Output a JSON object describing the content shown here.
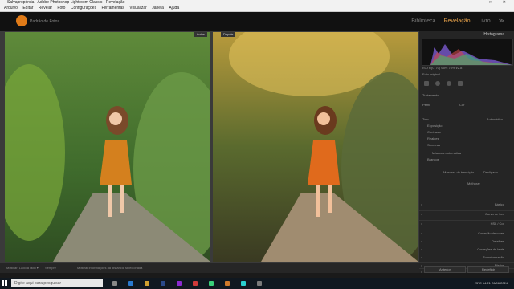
{
  "window": {
    "title": "Salvapropórcia - Adobe Photoshop Lightroom Classic - Revelação",
    "controls": "–  □  ✕"
  },
  "menu": [
    "Arquivo",
    "Editar",
    "Revelar",
    "Foto",
    "Configurações",
    "Ferramentas",
    "Visualizar",
    "Janela",
    "Ajuda"
  ],
  "identity": {
    "logo_text": "Padrão de Fotos",
    "modules": [
      "Biblioteca",
      "Revelação",
      "Livro",
      "≫"
    ],
    "active_module": "Revelação"
  },
  "views": {
    "before_label": "Antes",
    "after_label": "Depois"
  },
  "bottom_toolbar": {
    "left": "Mostrar: Lado a lado  ▾",
    "swap": "Sempre",
    "middle": "Mostrar informações da distância selecionada"
  },
  "right_panel": {
    "histogram_title": "Histograma",
    "readout": "ISO    R(G 70)    65%    75%    f/2.8",
    "original_photo": "Foto original",
    "preset_label": "Cor",
    "basic_labels": [
      "Tratamento",
      "Perfil",
      "Tom",
      "Exposição",
      "Contraste",
      "Realces",
      "Sombras",
      "Brancos"
    ],
    "auto_label": "Automático",
    "presence": "Máscara automática",
    "enhance_label": "Melhorar",
    "ca_label": "Máscara de transição",
    "ca_value": "Desligado",
    "sections": [
      "Básico",
      "Curva de tom",
      "HSL / Cor",
      "Correção de cores",
      "Detalhes",
      "Correções de lente",
      "Transformação",
      "Efeitos",
      "Calibração"
    ],
    "bottom_left": "Anterior",
    "bottom_right": "Redefinir"
  },
  "taskbar": {
    "search_placeholder": "Digite aqui para pesquisar",
    "temp": "25°C",
    "time": "14:21",
    "date": "26/06/2024"
  },
  "colors": {
    "accent": "#e8a24a",
    "panel": "#252525",
    "workspace": "#3a3a3a"
  }
}
